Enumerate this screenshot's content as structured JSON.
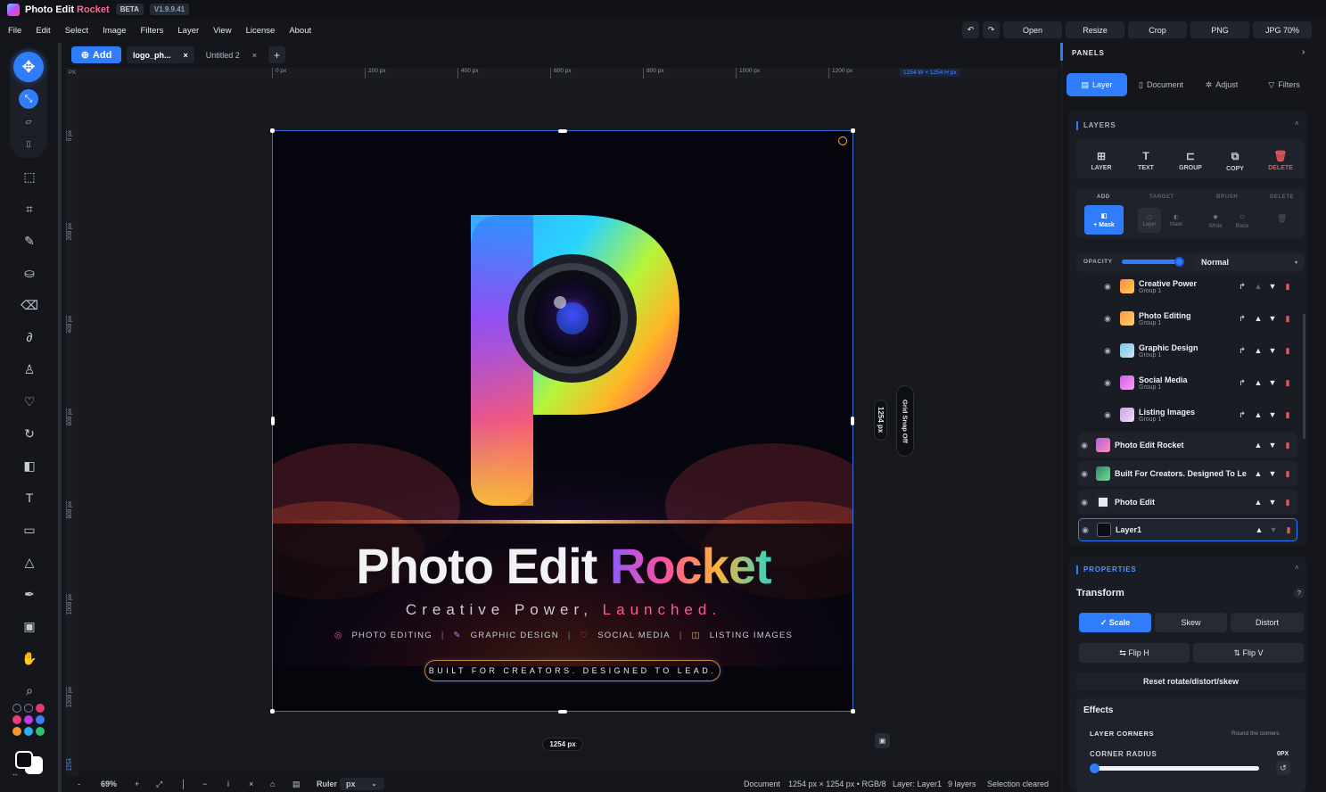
{
  "app": {
    "name": "Photo Edit",
    "name_accent": "Rocket",
    "badge": "BETA",
    "version": "V1.9.9.41"
  },
  "menu": [
    "File",
    "Edit",
    "Select",
    "Image",
    "Filters",
    "Layer",
    "View",
    "License",
    "About"
  ],
  "toolbar_right": {
    "undo": "↶",
    "redo": "↷",
    "open": "Open",
    "resize": "Resize",
    "crop": "Crop",
    "png": "PNG",
    "jpg": "JPG 70%"
  },
  "tabs": {
    "add": "Add",
    "items": [
      {
        "label": "logo_ph...",
        "close": "×"
      },
      {
        "label": "Untitled 2",
        "close": "×"
      }
    ],
    "new": "+"
  },
  "ruler": {
    "unit_corner": "PX",
    "top_ticks": [
      "0 px",
      "200 px",
      "400 px",
      "600 px",
      "800 px",
      "1000 px",
      "1200 px"
    ],
    "size_readout": "1254 W × 1254 H px",
    "left_ticks": [
      "0 px",
      "200 px",
      "400 px",
      "600 px",
      "800 px",
      "1000 px",
      "1200 px"
    ],
    "left_bottom": "1254"
  },
  "canvas": {
    "headline_a": "Photo Edit ",
    "headline_b": "Rocket",
    "tagline_a": "Creative Power, ",
    "tagline_b": "Launched.",
    "features": [
      "PHOTO EDITING",
      "GRAPHIC DESIGN",
      "SOCIAL MEDIA",
      "LISTING IMAGES"
    ],
    "separator": "|",
    "pill": "BUILT FOR CREATORS. DESIGNED TO LEAD.",
    "width_label": "1254 px",
    "height_label": "1254 px",
    "grid_snap": "Grid Snap Off"
  },
  "status": {
    "minus": "-",
    "zoom": "69%",
    "plus": "+",
    "ruler_label": "Ruler",
    "ruler_unit": "px",
    "document": "Document",
    "dims": "1254 px × 1254 px • RGB/8",
    "layer": "Layer: Layer1",
    "layers_count": "9 layers",
    "selection": "Selection cleared"
  },
  "panels": {
    "title": "PANELS",
    "tabs": [
      "Layer",
      "Document",
      "Adjust",
      "Filters"
    ],
    "layers_title": "LAYERS",
    "layer_tools": [
      "LAYER",
      "TEXT",
      "GROUP",
      "COPY",
      "DELETE"
    ],
    "mask": {
      "add": "ADD",
      "target": "TARGET",
      "brush": "BRUSH",
      "delete": "DELETE",
      "mask_btn": "+ Mask",
      "t_layer": "Layer",
      "t_mask": "Mask",
      "b_white": "White",
      "b_black": "Black"
    },
    "opacity_label": "OPACITY",
    "opacity_value": 0.93,
    "blend_mode": "Normal",
    "layers": [
      {
        "name": "Creative Power",
        "sub": "Group 1"
      },
      {
        "name": "Photo Editing",
        "sub": "Group 1"
      },
      {
        "name": "Graphic Design",
        "sub": "Group 1"
      },
      {
        "name": "Social Media",
        "sub": "Group 1"
      },
      {
        "name": "Listing Images",
        "sub": "Group 1"
      },
      {
        "name": "Photo Edit Rocket",
        "sub": ""
      },
      {
        "name": "Built For Creators. Designed To Le",
        "sub": ""
      },
      {
        "name": "Photo Edit",
        "sub": ""
      },
      {
        "name": "Layer1",
        "sub": ""
      }
    ],
    "properties_title": "PROPERTIES",
    "transform_title": "Transform",
    "help": "?",
    "transform_modes": [
      "✓ Scale",
      "Skew",
      "Distort"
    ],
    "flip_h": "⇆ Flip H",
    "flip_v": "⇅ Flip V",
    "reset": "Reset rotate/distort/skew",
    "effects_title": "Effects",
    "layer_corners": "LAYER CORNERS",
    "round_hint": "Round the corners",
    "corner_radius": "CORNER RADIUS",
    "corner_value": "0PX"
  },
  "colors": {
    "accent": "#2f7dfa",
    "bg": "#14161c",
    "danger": "#e05a5a"
  }
}
